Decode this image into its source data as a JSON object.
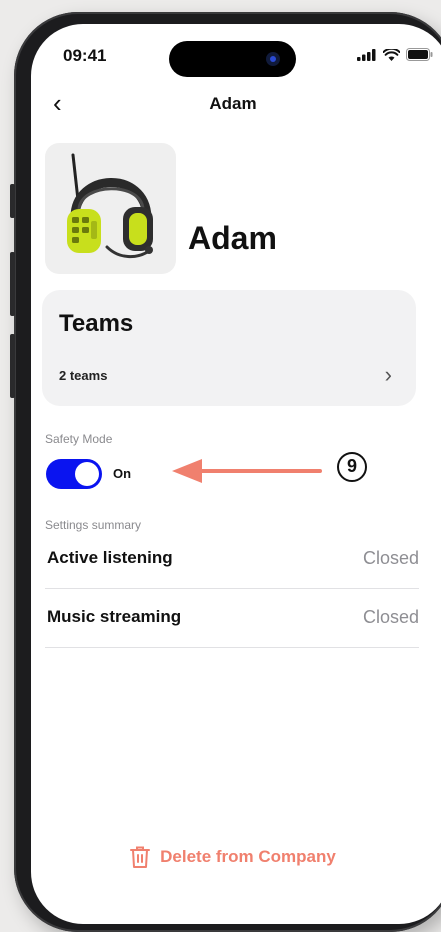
{
  "status_bar": {
    "time": "09:41"
  },
  "nav": {
    "back_glyph": "‹",
    "title": "Adam"
  },
  "profile": {
    "name": "Adam",
    "device_image": "headset-device-image"
  },
  "teams_card": {
    "title": "Teams",
    "subtitle": "2 teams",
    "chevron": "›"
  },
  "safety_mode": {
    "section_label": "Safety Mode",
    "toggle_on": true,
    "toggle_label": "On"
  },
  "settings_summary": {
    "section_label": "Settings summary",
    "rows": [
      {
        "label": "Active listening",
        "value": "Closed"
      },
      {
        "label": "Music streaming",
        "value": "Closed"
      }
    ]
  },
  "delete_action": {
    "label": "Delete from Company",
    "icon": "trash-icon"
  },
  "annotation": {
    "number": "9",
    "color": "#f0806e"
  },
  "colors": {
    "accent": "#0a14f0",
    "destructive": "#f0806e",
    "secondary_text": "#8e8e93"
  }
}
